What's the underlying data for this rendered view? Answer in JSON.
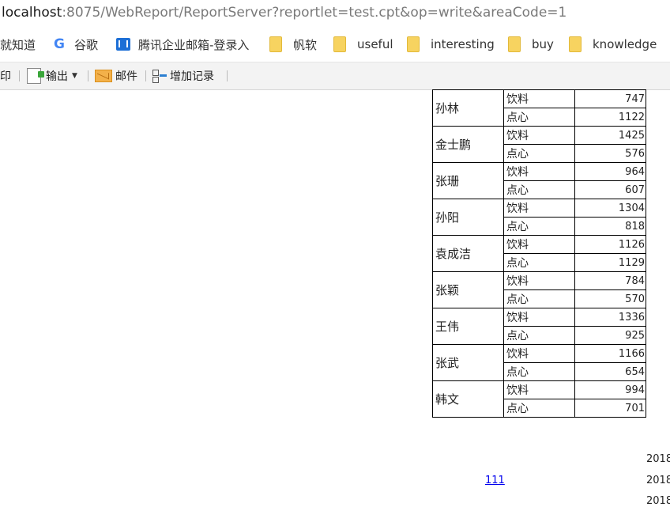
{
  "address_bar": {
    "host": "localhost",
    "path": ":8075/WebReport/ReportServer?reportlet=test.cpt&op=write&areaCode=1"
  },
  "bookmarks": [
    {
      "label": "就知道",
      "icon": "none"
    },
    {
      "label": "谷歌",
      "icon": "google-icon"
    },
    {
      "label": "腾讯企业邮箱-登录入",
      "icon": "tencent-mail-icon"
    },
    {
      "label": "帆软",
      "icon": "folder-icon"
    },
    {
      "label": "useful",
      "icon": "folder-icon"
    },
    {
      "label": "interesting",
      "icon": "folder-icon"
    },
    {
      "label": "buy",
      "icon": "folder-icon"
    },
    {
      "label": "knowledge",
      "icon": "folder-icon"
    }
  ],
  "toolbar": {
    "print": "印",
    "export": "输出",
    "email": "邮件",
    "add_record": "增加记录"
  },
  "report": {
    "rows": [
      {
        "name": "孙林",
        "items": [
          {
            "cat": "饮料",
            "value": "747"
          },
          {
            "cat": "点心",
            "value": "1122"
          }
        ]
      },
      {
        "name": "金士鹏",
        "items": [
          {
            "cat": "饮料",
            "value": "1425"
          },
          {
            "cat": "点心",
            "value": "576"
          }
        ]
      },
      {
        "name": "张珊",
        "items": [
          {
            "cat": "饮料",
            "value": "964"
          },
          {
            "cat": "点心",
            "value": "607"
          }
        ]
      },
      {
        "name": "孙阳",
        "items": [
          {
            "cat": "饮料",
            "value": "1304"
          },
          {
            "cat": "点心",
            "value": "818"
          }
        ]
      },
      {
        "name": "袁成洁",
        "items": [
          {
            "cat": "饮料",
            "value": "1126"
          },
          {
            "cat": "点心",
            "value": "1129"
          }
        ]
      },
      {
        "name": "张颖",
        "items": [
          {
            "cat": "饮料",
            "value": "784"
          },
          {
            "cat": "点心",
            "value": "570"
          }
        ]
      },
      {
        "name": "王伟",
        "items": [
          {
            "cat": "饮料",
            "value": "1336"
          },
          {
            "cat": "点心",
            "value": "925"
          }
        ]
      },
      {
        "name": "张武",
        "items": [
          {
            "cat": "饮料",
            "value": "1166"
          },
          {
            "cat": "点心",
            "value": "654"
          }
        ]
      },
      {
        "name": "韩文",
        "items": [
          {
            "cat": "饮料",
            "value": "994"
          },
          {
            "cat": "点心",
            "value": "701"
          }
        ]
      }
    ]
  },
  "footer": {
    "link_text": "111",
    "years": [
      "2018",
      "2018",
      "2018"
    ]
  }
}
